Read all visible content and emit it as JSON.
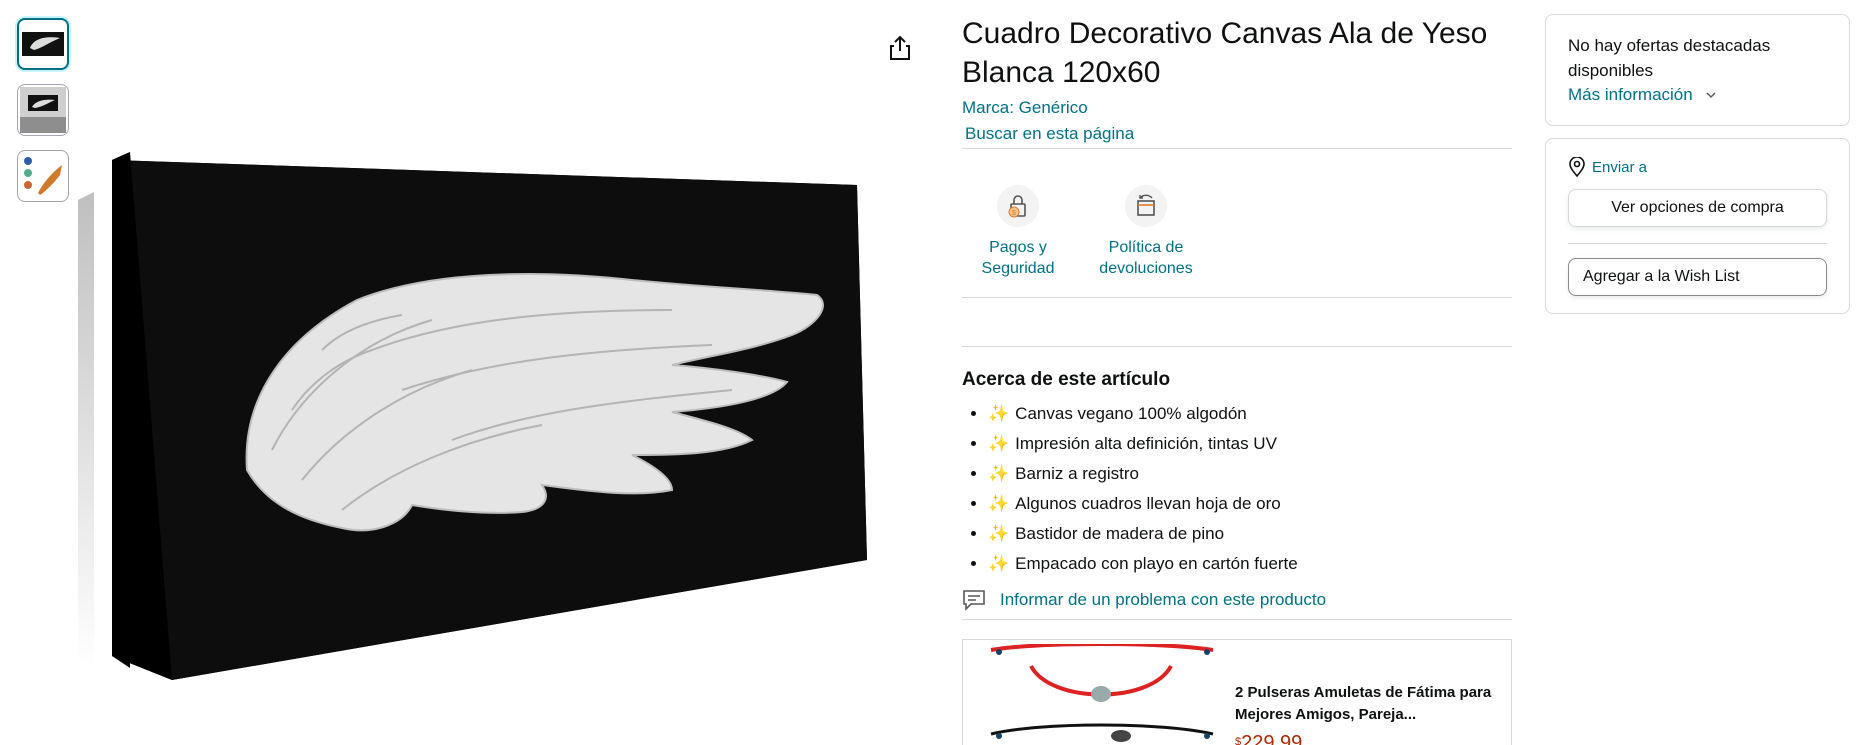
{
  "product": {
    "title": "Cuadro Decorativo Canvas Ala de Yeso Blanca 120x60",
    "brand": "Marca: Genérico",
    "search_page": "Buscar en esta página"
  },
  "badges": [
    {
      "label": "Pagos y Seguridad",
      "icon": "lock-payment-icon"
    },
    {
      "label": "Política de devoluciones",
      "icon": "return-box-icon"
    }
  ],
  "about": {
    "title": "Acerca de este artículo",
    "items": [
      "Canvas vegano 100% algodón",
      "Impresión alta definición, tintas UV",
      "Barniz a registro",
      "Algunos cuadros llevan hoja de oro",
      "Bastidor de madera de pino",
      "Empacado con playo en cartón fuerte"
    ],
    "bullet_emoji": "✨"
  },
  "report": "Informar de un problema con este producto",
  "ad": {
    "title": "2 Pulseras Amuletas de Fátima para Mejores Amigos, Pareja...",
    "currency": "$",
    "price": "229.99"
  },
  "buybox": {
    "no_offers": "No hay ofertas destacadas disponibles",
    "more_info": "Más información",
    "ship_to": "Enviar a",
    "see_options": "Ver opciones de compra",
    "wishlist": "Agregar a la Wish List"
  },
  "colors": {
    "link": "#007185",
    "price": "#b12704",
    "border": "#d5d9d9"
  }
}
